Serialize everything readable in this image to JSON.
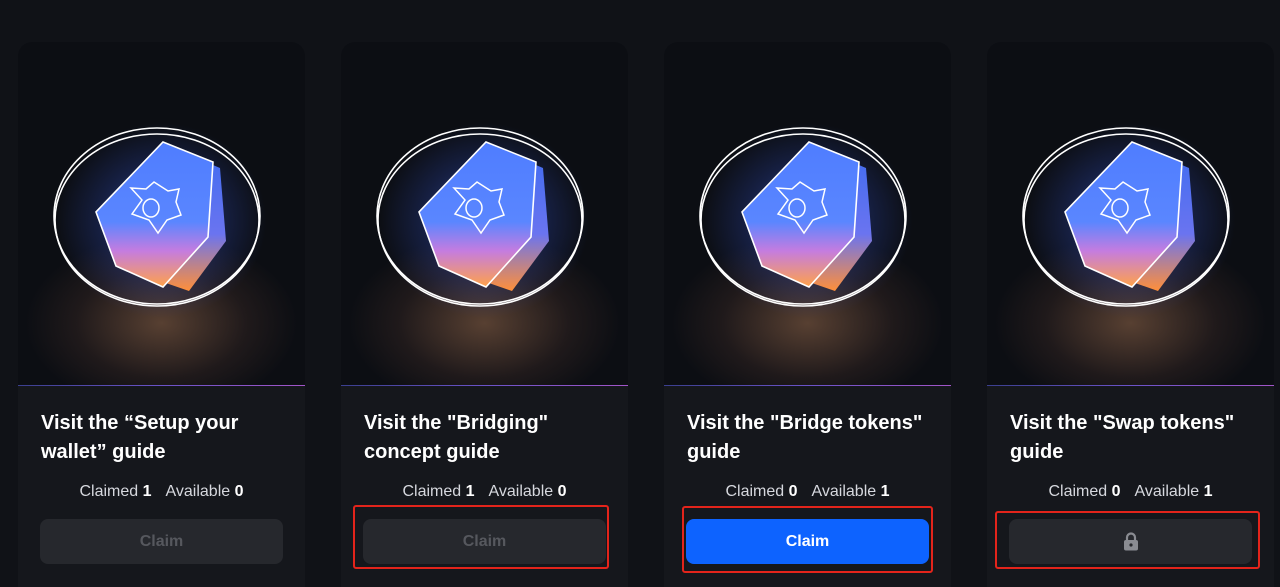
{
  "colors": {
    "background": "#101217",
    "card": "#15171c",
    "primary_button": "#0d63ff",
    "disabled_button": "#26282d",
    "highlight": "#e3241b"
  },
  "cards": [
    {
      "title": "Visit the “Setup your wallet” guide",
      "claimed_label": "Claimed",
      "claimed": "1",
      "available_label": "Available",
      "available": "0",
      "button_label": "Claim",
      "button_state": "disabled",
      "badge_icon": "hexagon-badge-icon"
    },
    {
      "title": "Visit the \"Bridging\" concept guide",
      "claimed_label": "Claimed",
      "claimed": "1",
      "available_label": "Available",
      "available": "0",
      "button_label": "Claim",
      "button_state": "disabled",
      "badge_icon": "hexagon-badge-icon"
    },
    {
      "title": "Visit the \"Bridge tokens\" guide",
      "claimed_label": "Claimed",
      "claimed": "0",
      "available_label": "Available",
      "available": "1",
      "button_label": "Claim",
      "button_state": "active",
      "badge_icon": "hexagon-badge-icon"
    },
    {
      "title": "Visit the \"Swap tokens\" guide",
      "claimed_label": "Claimed",
      "claimed": "0",
      "available_label": "Available",
      "available": "1",
      "button_label": "",
      "button_state": "locked",
      "badge_icon": "hexagon-badge-icon",
      "button_icon": "lock-icon"
    }
  ]
}
